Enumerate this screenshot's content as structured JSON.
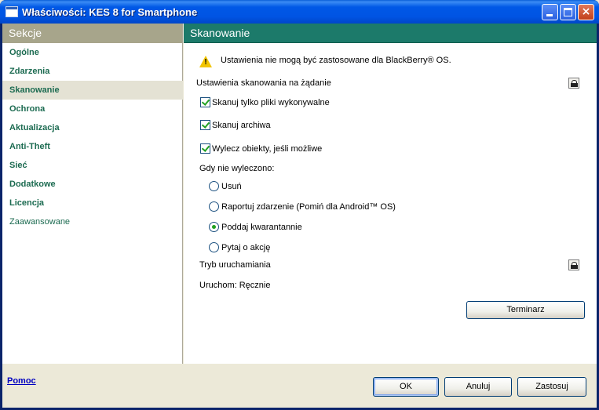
{
  "window": {
    "title": "Właściwości: KES 8 for Smartphone",
    "close_glyph": "×"
  },
  "sidebar": {
    "header": "Sekcje",
    "items": [
      {
        "label": "Ogólne"
      },
      {
        "label": "Zdarzenia"
      },
      {
        "label": "Skanowanie",
        "active": true
      },
      {
        "label": "Ochrona"
      },
      {
        "label": "Aktualizacja"
      },
      {
        "label": "Anti-Theft"
      },
      {
        "label": "Sieć"
      },
      {
        "label": "Dodatkowe"
      },
      {
        "label": "Licencja"
      },
      {
        "label": "Zaawansowane"
      }
    ]
  },
  "pane": {
    "header": "Skanowanie",
    "warning": "Ustawienia nie mogą być zastosowane dla BlackBerry® OS.",
    "scan_section": "Ustawienia skanowania na żądanie",
    "options": [
      {
        "label": "Skanuj tylko pliki wykonywalne",
        "checked": true
      },
      {
        "label": "Skanuj archiwa",
        "checked": true
      },
      {
        "label": "Wylecz obiekty, jeśli możliwe",
        "checked": true
      }
    ],
    "not_cured_label": "Gdy nie wyleczono:",
    "radios": [
      {
        "label": "Usuń",
        "checked": false
      },
      {
        "label": "Raportuj zdarzenie (Pomiń dla Android™ OS)",
        "checked": false
      },
      {
        "label": "Poddaj kwarantannie",
        "checked": true
      },
      {
        "label": "Pytaj o akcję",
        "checked": false
      }
    ],
    "run_section": "Tryb uruchamiania",
    "run_value": "Uruchom: Ręcznie",
    "schedule_button": "Terminarz"
  },
  "footer": {
    "help_link": "Pomoc",
    "ok": "OK",
    "cancel": "Anuluj",
    "apply": "Zastosuj"
  },
  "colors": {
    "sidebar_header": "#a7a58b",
    "pane_header": "#1c7a6a",
    "nav_text": "#1c6b51",
    "warning": "#f2c500"
  }
}
